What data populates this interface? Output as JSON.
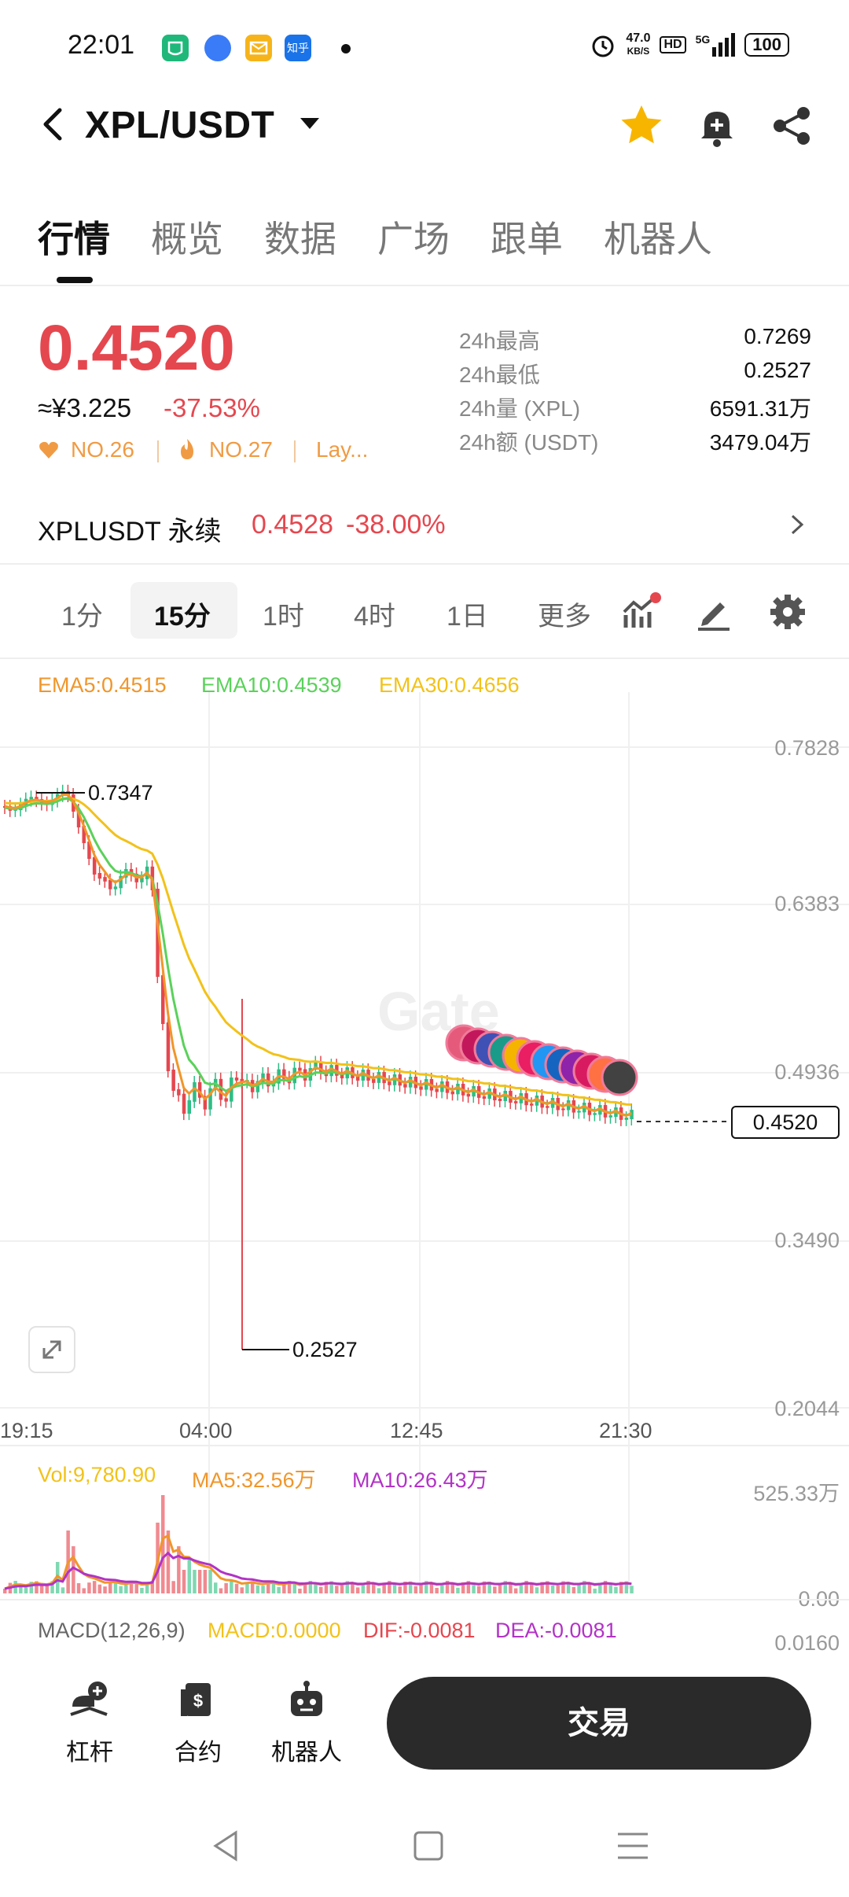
{
  "status_bar": {
    "time": "22:01",
    "apps": [
      {
        "icon": "wechat-shield-icon",
        "color": "#1fb87a"
      },
      {
        "icon": "blue-bird-icon",
        "color": "#3a7bf7"
      },
      {
        "icon": "mail-icon",
        "color": "#f6b41a"
      },
      {
        "icon": "zhihu-icon",
        "color": "#1a73e8",
        "text": "知乎"
      }
    ],
    "speed_top": "47.0",
    "speed_unit": "KB/S",
    "hd": "HD",
    "network": "5G",
    "battery": "100"
  },
  "header": {
    "title": "XPL/USDT",
    "icons": [
      "back-icon",
      "star-icon",
      "bell-plus-icon",
      "share-icon"
    ],
    "star_color": "#f7b500"
  },
  "main_tabs": [
    {
      "label": "行情",
      "active": true
    },
    {
      "label": "概览",
      "active": false
    },
    {
      "label": "数据",
      "active": false
    },
    {
      "label": "广场",
      "active": false
    },
    {
      "label": "跟单",
      "active": false
    },
    {
      "label": "机器人",
      "active": false
    }
  ],
  "price": {
    "last": "0.4520",
    "cny": "≈¥3.225",
    "change": "-37.53%",
    "ranks": [
      "NO.26",
      "NO.27",
      "Lay..."
    ],
    "color_down": "#e5474f"
  },
  "stats": [
    {
      "label": "24h最高",
      "value": "0.7269"
    },
    {
      "label": "24h最低",
      "value": "0.2527"
    },
    {
      "label": "24h量 (XPL)",
      "value": "6591.31万"
    },
    {
      "label": "24h额 (USDT)",
      "value": "3479.04万"
    }
  ],
  "perpetual": {
    "name": "XPLUSDT 永续",
    "price": "0.4528",
    "change": "-38.00%"
  },
  "intervals": [
    {
      "label": "1分",
      "active": false
    },
    {
      "label": "15分",
      "active": true
    },
    {
      "label": "1时",
      "active": false
    },
    {
      "label": "4时",
      "active": false
    },
    {
      "label": "1日",
      "active": false
    },
    {
      "label": "更多",
      "active": false
    }
  ],
  "ema_legend": [
    {
      "label": "EMA5:0.4515",
      "color": "#f0962a"
    },
    {
      "label": "EMA10:0.4539",
      "color": "#5bd15b"
    },
    {
      "label": "EMA30:0.4656",
      "color": "#f2c21a"
    }
  ],
  "chart_data": {
    "type": "candlestick",
    "y_axis_labels": [
      "0.7828",
      "0.6383",
      "0.4936",
      "0.3490",
      "0.2044"
    ],
    "x_axis_labels": [
      "19:15",
      "04:00",
      "12:45",
      "21:30"
    ],
    "ylim": [
      0.2044,
      0.7828
    ],
    "high_marker": "0.7347",
    "low_marker": "0.2527",
    "last_price_tag": "0.4520",
    "watermark": "Gate"
  },
  "volume_legend": [
    {
      "label": "Vol:9,780.90",
      "color": "#f2c21a"
    },
    {
      "label": "MA5:32.56万",
      "color": "#f0962a"
    },
    {
      "label": "MA10:26.43万",
      "color": "#b233c6"
    }
  ],
  "volume_axis": [
    "525.33万",
    "0.00"
  ],
  "macd_legend": [
    {
      "label": "MACD(12,26,9)",
      "color": "#666666"
    },
    {
      "label": "MACD:0.0000",
      "color": "#f2c21a"
    },
    {
      "label": "DIF:-0.0081",
      "color": "#e5474f"
    },
    {
      "label": "DEA:-0.0081",
      "color": "#b233c6"
    }
  ],
  "macd_axis": "0.0160",
  "bottom_nav": [
    {
      "label": "杠杆",
      "icon": "leverage-icon"
    },
    {
      "label": "合约",
      "icon": "contract-icon"
    },
    {
      "label": "机器人",
      "icon": "robot-icon"
    }
  ],
  "trade_button": "交易"
}
